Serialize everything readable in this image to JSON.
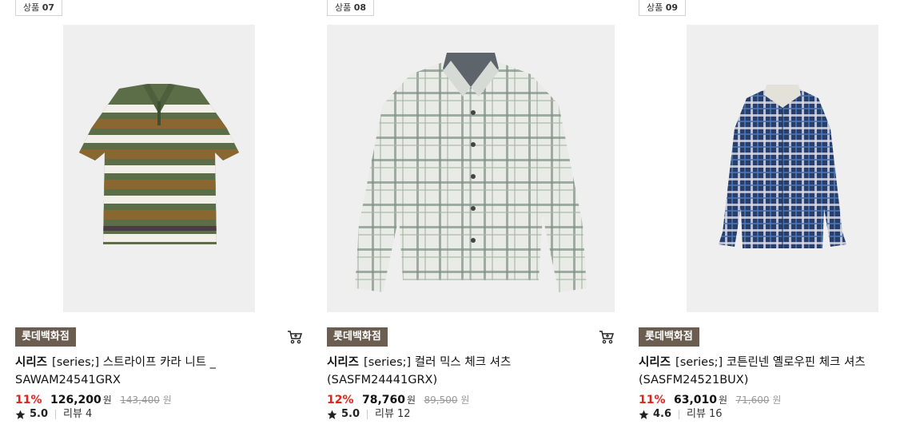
{
  "products": [
    {
      "label": "상품",
      "number": "07",
      "store": "롯데백화점",
      "brand": "시리즈",
      "name": "[series;] 스트라이프 카라 니트 _ SAWAM24541GRX",
      "discount": "11%",
      "price": "126,200",
      "currency": "원",
      "original_price": "143,400",
      "rating": "5.0",
      "review_label": "리뷰",
      "review_count": "4",
      "image_icon": "striped-polo-knit-image",
      "colors": {
        "green": "#5b6e48",
        "brown": "#8a6630",
        "white": "#f1efe8"
      }
    },
    {
      "label": "상품",
      "number": "08",
      "store": "롯데백화점",
      "brand": "시리즈",
      "name": "[series;] 컬러 믹스 체크 셔츠 (SASFM24441GRX)",
      "discount": "12%",
      "price": "78,760",
      "currency": "원",
      "original_price": "89,500",
      "rating": "5.0",
      "review_label": "리뷰",
      "review_count": "12",
      "image_icon": "light-check-shirt-image",
      "colors": {
        "base": "#e9ece6",
        "line": "#7f9084"
      }
    },
    {
      "label": "상품",
      "number": "09",
      "store": "롯데백화점",
      "brand": "시리즈",
      "name": "[series;] 코튼린넨 옐로우핀 체크 셔츠 (SASFM24521BUX)",
      "discount": "11%",
      "price": "63,010",
      "currency": "원",
      "original_price": "71,600",
      "rating": "4.6",
      "review_label": "리뷰",
      "review_count": "16",
      "image_icon": "navy-check-shirt-image",
      "colors": {
        "base": "#2b3d6b",
        "line": "#d9dde6"
      }
    }
  ],
  "theme": {
    "discount_color": "#e2231a",
    "store_tag_bg": "#6b5d4f"
  }
}
